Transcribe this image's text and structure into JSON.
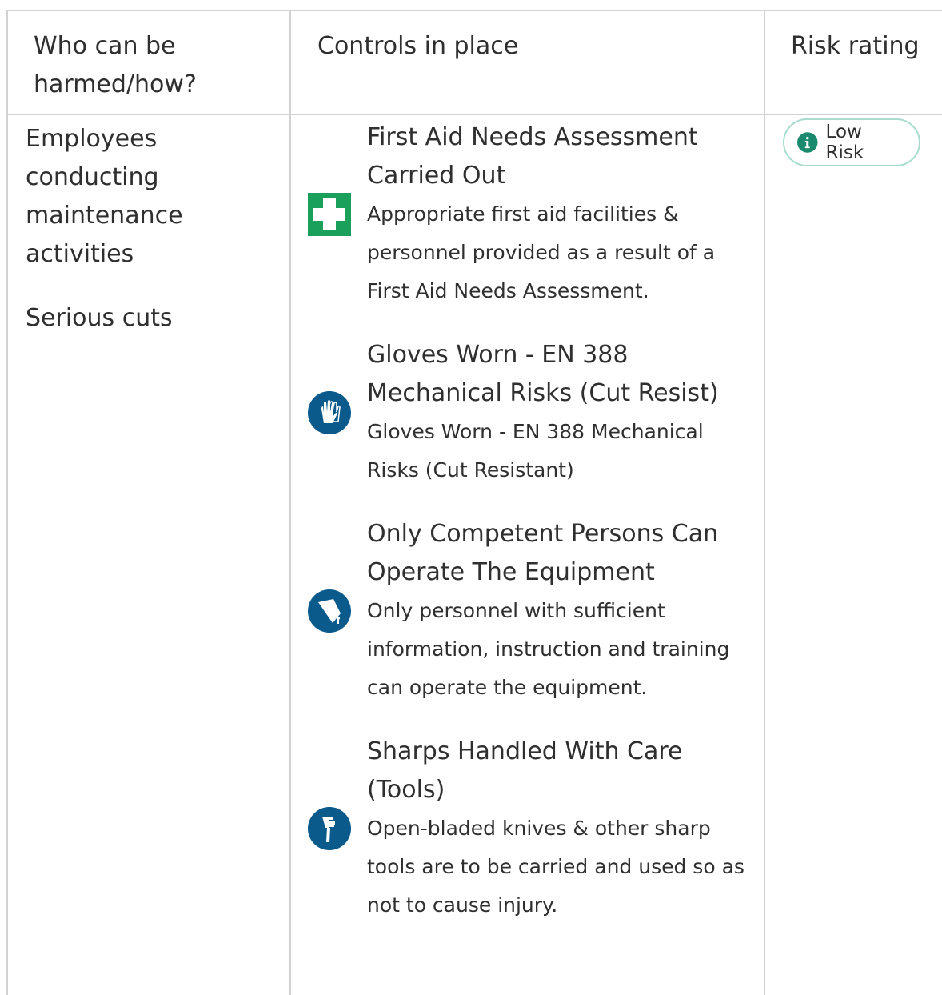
{
  "header": {
    "who": "Who can be harmed/how?",
    "controls": "Controls in place",
    "risk": "Risk rating"
  },
  "row": {
    "who": "Employees conducting maintenance activities",
    "harm": "Serious cuts",
    "risk_badge": {
      "label": "Low Risk",
      "icon": "info-icon",
      "accent_color": "#1a8a6e"
    }
  },
  "controls": [
    {
      "icon": "first-aid-icon",
      "title": "First Aid Needs Assessment Carried Out",
      "description": "Appropriate first aid facilities & personnel provided as a result of a First Aid Needs Assessment."
    },
    {
      "icon": "gloves-icon",
      "title": "Gloves Worn - EN 388 Mechanical Risks (Cut Resist)",
      "description": "Gloves Worn - EN 388 Mechanical Risks (Cut Resistant)"
    },
    {
      "icon": "instruction-manual-icon",
      "title": "Only Competent Persons Can Operate The Equipment",
      "description": "Only personnel with sufficient information, instruction and training can operate the equipment."
    },
    {
      "icon": "knife-hand-icon",
      "title": "Sharps Handled With Care (Tools)",
      "description": "Open-bladed knives & other sharp tools are to be carried and used so as not to cause injury."
    }
  ],
  "colors": {
    "first_aid_green": "#1aa05a",
    "mandatory_blue": "#0b5a8c",
    "border_grey": "#d2d2d2"
  }
}
